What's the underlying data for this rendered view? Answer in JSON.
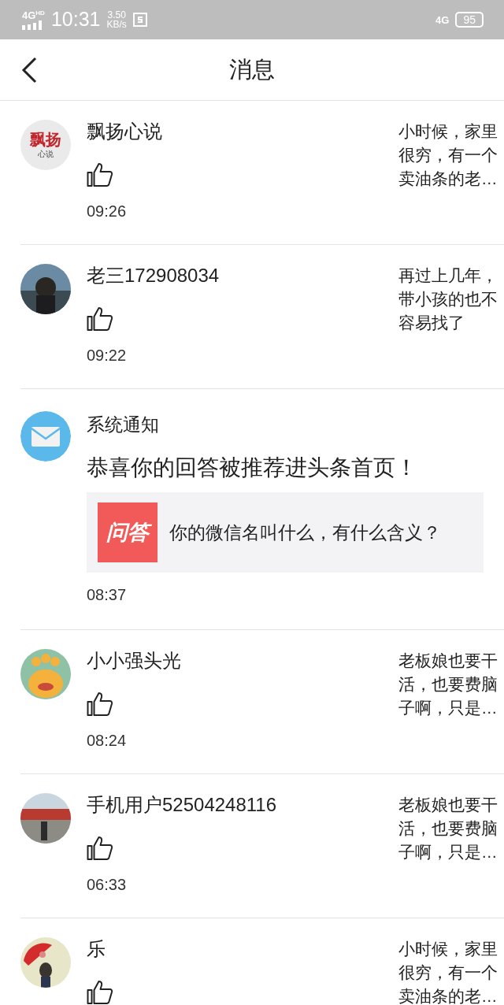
{
  "status_bar": {
    "network": "4G",
    "network_badge": "HD",
    "time": "10:31",
    "speed": "3.50",
    "speed_unit": "KB/s",
    "network_right": "4G",
    "battery": "95"
  },
  "header": {
    "title": "消息"
  },
  "messages": [
    {
      "kind": "comment",
      "avatar": {
        "kind": "logo",
        "line1": "飘扬",
        "line2": "心说"
      },
      "name": "飘扬心说",
      "time": "09:26",
      "excerpt": "小时候，家里很穷，有一个卖油条的老…"
    },
    {
      "kind": "comment",
      "name": "老三172908034",
      "time": "09:22",
      "excerpt": "再过上几年，带小孩的也不容易找了"
    },
    {
      "kind": "system",
      "name": "系统通知",
      "headline": "恭喜你的回答被推荐进头条首页！",
      "card": {
        "badge": "问答",
        "question": "你的微信名叫什么，有什么含义？"
      },
      "time": "08:37"
    },
    {
      "kind": "comment",
      "name": "小小强头光",
      "time": "08:24",
      "excerpt": "老板娘也要干活，也要费脑子啊，只是…"
    },
    {
      "kind": "comment",
      "name": "手机用户52504248116",
      "time": "06:33",
      "excerpt": "老板娘也要干活，也要费脑子啊，只是…"
    },
    {
      "kind": "comment",
      "name": "乐",
      "excerpt": "小时候，家里很穷，有一个卖油条的老…"
    }
  ]
}
